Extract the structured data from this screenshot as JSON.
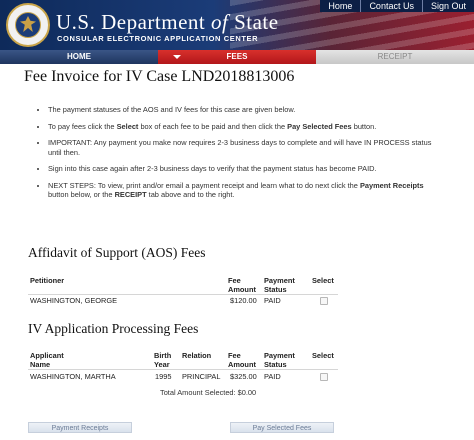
{
  "header": {
    "title_main": "U.S. Department",
    "title_of": "of",
    "title_state": "State",
    "subtitle": "CONSULAR ELECTRONIC APPLICATION CENTER",
    "links": [
      "Home",
      "Contact Us",
      "Sign Out"
    ]
  },
  "nav": {
    "home": "HOME",
    "fees": "FEES",
    "receipt": "RECEIPT"
  },
  "page_title": "Fee Invoice for IV Case LND2018813006",
  "instructions": {
    "item1": "The payment statuses of the AOS and IV fees for this case are given below.",
    "item2_a": "To pay fees click the ",
    "item2_b": "Select",
    "item2_c": " box of each fee to be paid and then click the ",
    "item2_d": "Pay Selected Fees",
    "item2_e": " button.",
    "item3": "IMPORTANT: Any payment you make now requires 2-3 business days to complete and will have IN PROCESS status until then.",
    "item4": "Sign into this case again after 2-3 business days to verify that the payment status has become PAID.",
    "item5_a": "NEXT STEPS: To view, print and/or email a payment receipt and learn what to do next click the ",
    "item5_b": "Payment Receipts",
    "item5_c": " button below, or the ",
    "item5_d": "RECEIPT",
    "item5_e": " tab above and to the right."
  },
  "aos": {
    "title": "Affidavit of Support (AOS) Fees",
    "col_petitioner": "Petitioner",
    "col_fee_amount": "Fee Amount",
    "col_payment_status": "Payment Status",
    "col_select": "Select",
    "rows": [
      {
        "petitioner": "WASHINGTON, GEORGE",
        "fee": "$120.00",
        "status": "PAID"
      }
    ]
  },
  "iv": {
    "title": "IV Application Processing Fees",
    "col_applicant": "Applicant Name",
    "col_birth_year": "Birth Year",
    "col_relation": "Relation",
    "col_fee_amount": "Fee Amount",
    "col_payment_status": "Payment Status",
    "col_select": "Select",
    "rows": [
      {
        "applicant": "WASHINGTON, MARTHA",
        "birth_year": "1995",
        "relation": "PRINCIPAL",
        "fee": "$325.00",
        "status": "PAID"
      }
    ]
  },
  "total": "Total Amount Selected: $0.00",
  "buttons": {
    "payment_receipts": "Payment Receipts",
    "pay_selected": "Pay Selected Fees"
  }
}
